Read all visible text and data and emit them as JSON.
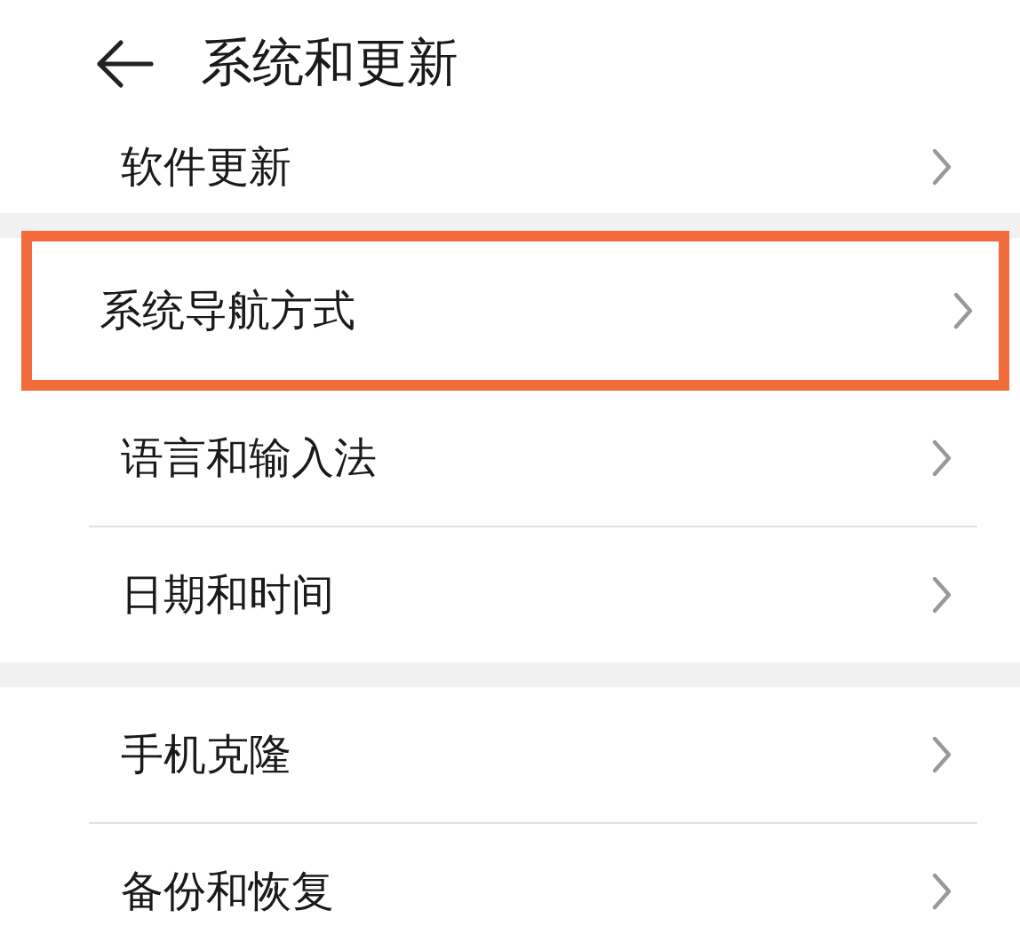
{
  "header": {
    "title": "系统和更新"
  },
  "groups": [
    {
      "items": [
        {
          "label": "软件更新",
          "highlighted": false
        }
      ]
    },
    {
      "items": [
        {
          "label": "系统导航方式",
          "highlighted": true
        },
        {
          "label": "语言和输入法",
          "highlighted": false
        },
        {
          "label": "日期和时间",
          "highlighted": false
        }
      ]
    },
    {
      "items": [
        {
          "label": "手机克隆",
          "highlighted": false
        },
        {
          "label": "备份和恢复",
          "highlighted": false
        }
      ]
    }
  ]
}
